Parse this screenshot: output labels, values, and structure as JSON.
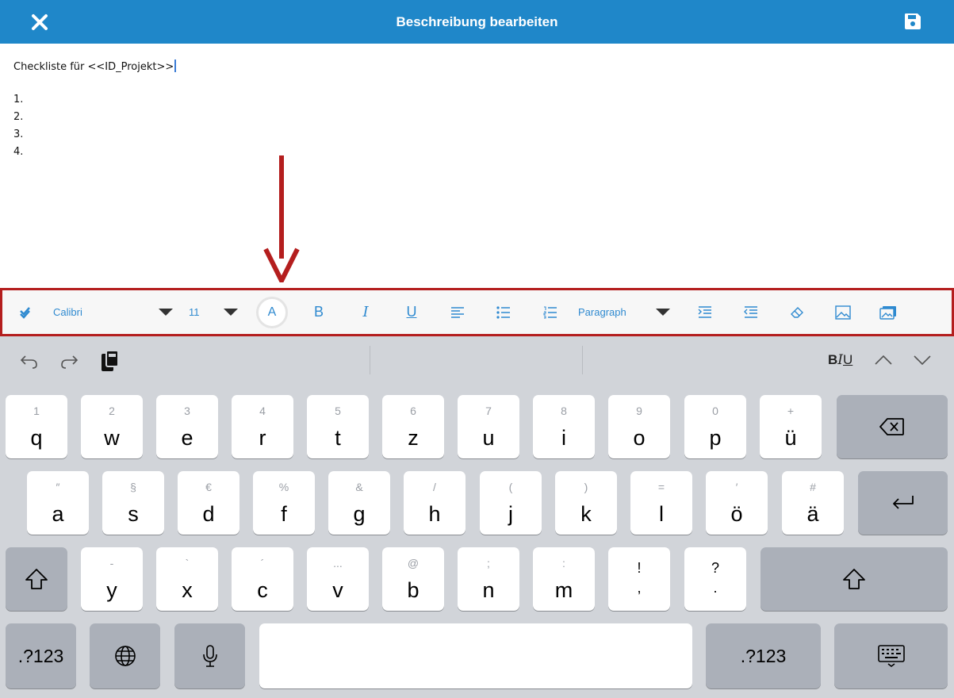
{
  "header": {
    "title": "Beschreibung bearbeiten",
    "bg_color": "#1f87c9",
    "close_icon": "close-icon",
    "save_icon": "save-icon"
  },
  "editor": {
    "first_line": "Checkliste für <<ID_Projekt>>",
    "list_items": [
      "1.",
      "2.",
      "3.",
      "4."
    ]
  },
  "toolbar": {
    "highlight_color": "#b41e1e",
    "accent_color": "#2f8ad0",
    "font_family": "Calibri",
    "font_size": "11",
    "text_color_label": "A",
    "bold_label": "B",
    "italic_label": "I",
    "underline_label": "U",
    "block_format": "Paragraph",
    "icons": [
      "check-icon",
      "align-left-icon",
      "bullet-list-icon",
      "numbered-list-icon",
      "indent-icon",
      "outdent-icon",
      "eraser-icon",
      "image-icon",
      "gallery-icon"
    ]
  },
  "keyboard": {
    "shortcut_bar": {
      "biu_bold": "B",
      "biu_italic": "I",
      "biu_underline": "U",
      "icons": [
        "undo-icon",
        "redo-icon",
        "paste-icon",
        "chevron-up-icon",
        "chevron-down-icon"
      ]
    },
    "row1": [
      {
        "hint": "1",
        "label": "q"
      },
      {
        "hint": "2",
        "label": "w"
      },
      {
        "hint": "3",
        "label": "e"
      },
      {
        "hint": "4",
        "label": "r"
      },
      {
        "hint": "5",
        "label": "t"
      },
      {
        "hint": "6",
        "label": "z"
      },
      {
        "hint": "7",
        "label": "u"
      },
      {
        "hint": "8",
        "label": "i"
      },
      {
        "hint": "9",
        "label": "o"
      },
      {
        "hint": "0",
        "label": "p"
      },
      {
        "hint": "+",
        "label": "ü"
      }
    ],
    "row2": [
      {
        "hint": "″",
        "label": "a"
      },
      {
        "hint": "§",
        "label": "s"
      },
      {
        "hint": "€",
        "label": "d"
      },
      {
        "hint": "%",
        "label": "f"
      },
      {
        "hint": "&",
        "label": "g"
      },
      {
        "hint": "/",
        "label": "h"
      },
      {
        "hint": "(",
        "label": "j"
      },
      {
        "hint": ")",
        "label": "k"
      },
      {
        "hint": "=",
        "label": "l"
      },
      {
        "hint": "′",
        "label": "ö"
      },
      {
        "hint": "#",
        "label": "ä"
      }
    ],
    "row3": [
      {
        "hint": "-",
        "label": "y"
      },
      {
        "hint": "`",
        "label": "x"
      },
      {
        "hint": "´",
        "label": "c"
      },
      {
        "hint": "...",
        "label": "v"
      },
      {
        "hint": "@",
        "label": "b"
      },
      {
        "hint": ";",
        "label": "n"
      },
      {
        "hint": ":",
        "label": "m"
      }
    ],
    "punct_keys": [
      {
        "top": "!",
        "bottom": ","
      },
      {
        "top": "?",
        "bottom": "."
      }
    ],
    "numbers_label": ".?123",
    "special_icons": [
      "backspace-icon",
      "return-icon",
      "shift-icon",
      "globe-icon",
      "microphone-icon",
      "keyboard-dismiss-icon"
    ]
  }
}
